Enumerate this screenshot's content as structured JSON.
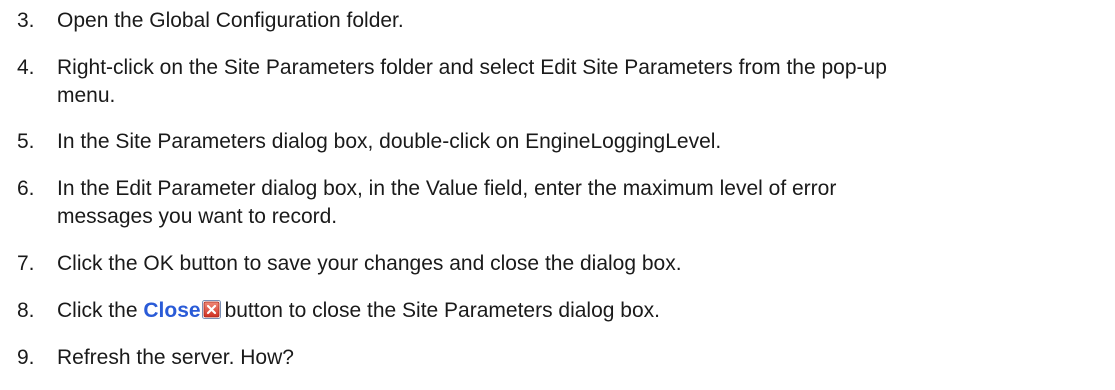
{
  "steps": [
    {
      "num": "3.",
      "text": "Open the Global Configuration folder."
    },
    {
      "num": "4.",
      "line1": "Right-click on the Site Parameters folder and select Edit Site Parameters from the pop-up",
      "line2": "menu."
    },
    {
      "num": "5.",
      "text": "In the Site Parameters dialog box, double-click on EngineLoggingLevel."
    },
    {
      "num": "6.",
      "line1": "In the Edit Parameter dialog box, in the Value field, enter the maximum level of error",
      "line2": "messages you want to record."
    },
    {
      "num": "7.",
      "text": "Click the OK button to save your changes and close the dialog box."
    },
    {
      "num": "8.",
      "before": "Click the",
      "link": "Close",
      "after": "button to close the Site Parameters dialog box."
    },
    {
      "num": "9.",
      "text": "Refresh the server. How?"
    }
  ],
  "colors": {
    "link": "#2a5bd7",
    "close_icon_fill": "#e24a3b"
  }
}
